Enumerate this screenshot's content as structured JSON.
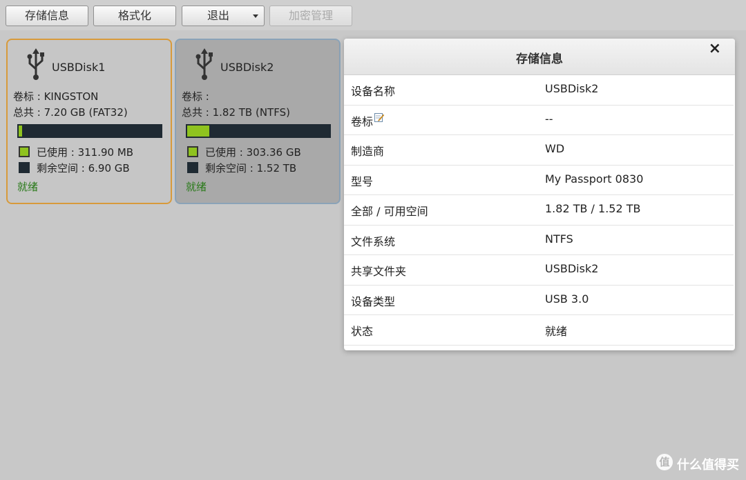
{
  "toolbar": {
    "storage_info": "存储信息",
    "format": "格式化",
    "eject": "退出",
    "encryption": "加密管理"
  },
  "disks": [
    {
      "name": "USBDisk1",
      "label_line": "卷标 : KINGSTON",
      "total_line": "总共 : 7.20 GB (FAT32)",
      "used_fraction": 0.043,
      "used_line": "已使用 : 311.90 MB",
      "free_line": "剩余空间 : 6.90 GB",
      "status": "就绪"
    },
    {
      "name": "USBDisk2",
      "label_line": "卷标 :",
      "total_line": "总共 : 1.82 TB (NTFS)",
      "used_fraction": 0.17,
      "used_line": "已使用 : 303.36 GB",
      "free_line": "剩余空间 : 1.52 TB",
      "status": "就绪"
    }
  ],
  "dialog": {
    "title": "存储信息",
    "close": "×",
    "rows": [
      {
        "label": "设备名称",
        "value": "USBDisk2"
      },
      {
        "label": "卷标",
        "value": "--"
      },
      {
        "label": "制造商",
        "value": "WD"
      },
      {
        "label": "型号",
        "value": "My Passport 0830"
      },
      {
        "label": "全部 / 可用空间",
        "value": "1.82 TB / 1.52 TB"
      },
      {
        "label": "文件系统",
        "value": "NTFS"
      },
      {
        "label": "共享文件夹",
        "value": "USBDisk2"
      },
      {
        "label": "设备类型",
        "value": "USB 3.0"
      },
      {
        "label": "状态",
        "value": "就绪"
      }
    ]
  },
  "watermark": {
    "logo_char": "值",
    "text": "什么值得买"
  },
  "colors": {
    "used": "#8fc31f",
    "free": "#1f2a33",
    "status_ready": "#2a7a1a",
    "selected_border": "#d89a3a"
  }
}
